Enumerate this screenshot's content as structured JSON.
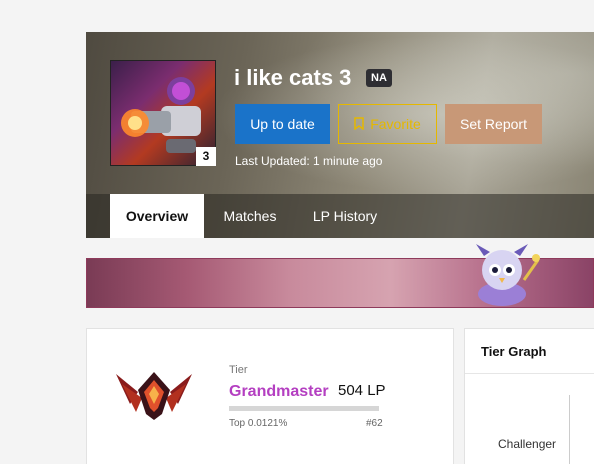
{
  "profile": {
    "name": "i like cats 3",
    "region": "NA",
    "level": "3",
    "last_updated": "Last Updated: 1 minute ago"
  },
  "actions": {
    "update_label": "Up to date",
    "favorite_label": "Favorite",
    "report_label": "Set Report"
  },
  "tabs": [
    {
      "label": "Overview",
      "active": true
    },
    {
      "label": "Matches",
      "active": false
    },
    {
      "label": "LP History",
      "active": false
    }
  ],
  "rank": {
    "tier_label": "Tier",
    "tier_name": "Grandmaster",
    "lp": "504 LP",
    "top_percent": "Top 0.0121%",
    "position": "#62"
  },
  "tier_graph": {
    "title": "Tier Graph",
    "tick_label": "Challenger"
  },
  "colors": {
    "primary_button": "#1a73c9",
    "favorite_accent": "#e5b800",
    "report_button": "#c89877",
    "tier_color": "#b43fc1"
  }
}
